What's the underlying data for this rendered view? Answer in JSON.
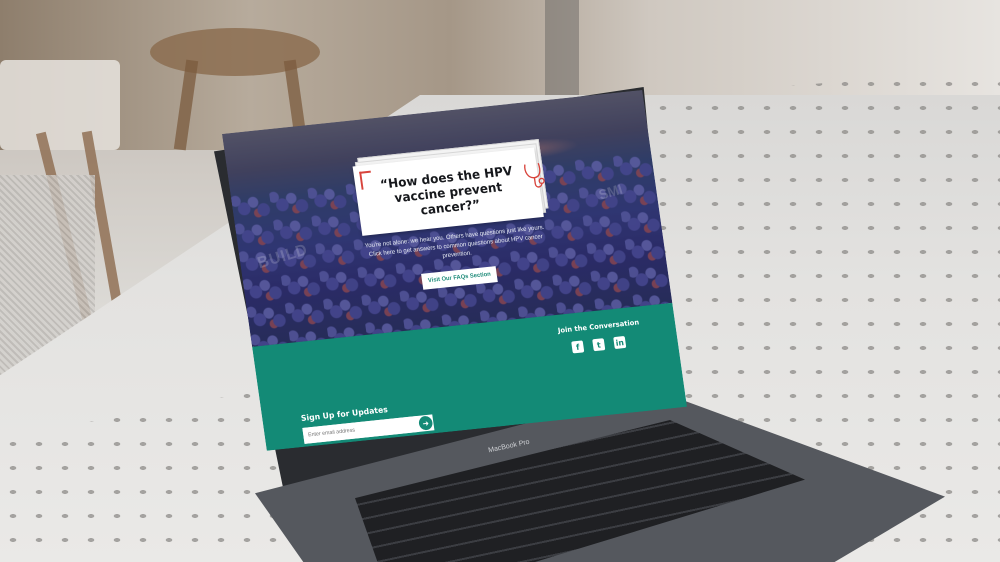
{
  "hero": {
    "quote": "“How does the HPV vaccine prevent cancer?”",
    "intro_text": "You're not alone: we hear you. Others have questions just like yours. Click here to get answers to common questions about HPV cancer prevention.",
    "faq_button_label": "Visit Our FAQs Section",
    "watermark_left": "BUILD",
    "watermark_right": "SMI"
  },
  "social": {
    "title": "Join the Conversation",
    "icons": [
      "facebook-icon",
      "twitter-icon",
      "linkedin-icon"
    ]
  },
  "signup": {
    "title": "Sign Up for Updates",
    "email_placeholder": "Enter email address",
    "submit_icon": "arrow-right-icon"
  },
  "device": {
    "label": "MacBook Pro"
  },
  "colors": {
    "teal": "#138a76",
    "accent_red": "#d8443c"
  }
}
